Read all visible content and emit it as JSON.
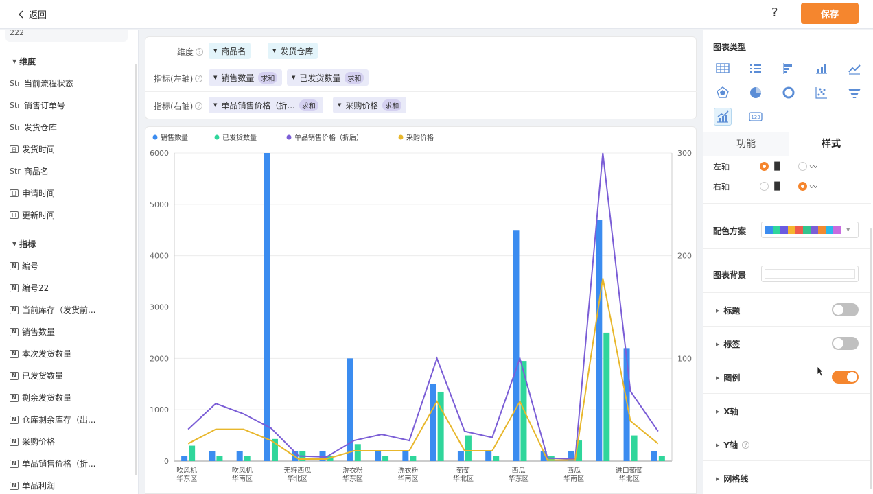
{
  "topbar": {
    "back_label": "返回",
    "help_label": "?",
    "save_label": "保存"
  },
  "left_panel": {
    "top_field": "222",
    "dimension_title": "维度",
    "dimensions": [
      {
        "type": "Str",
        "label": "当前流程状态"
      },
      {
        "type": "Str",
        "label": "销售订单号"
      },
      {
        "type": "Str",
        "label": "发货仓库"
      },
      {
        "type": "date",
        "label": "发货时间"
      },
      {
        "type": "Str",
        "label": "商品名"
      },
      {
        "type": "date",
        "label": "申请时间"
      },
      {
        "type": "date",
        "label": "更新时间"
      }
    ],
    "metric_title": "指标",
    "metrics": [
      "编号",
      "编号22",
      "当前库存（发货前...",
      "销售数量",
      "本次发货数量",
      "已发货数量",
      "剩余发货数量",
      "仓库剩余库存（出...",
      "采购价格",
      "单品销售价格（折...",
      "单品利润"
    ],
    "date_icon": "日",
    "num_icon": "N"
  },
  "config": {
    "dimension_label": "维度",
    "left_metric_label": "指标(左轴)",
    "right_metric_label": "指标(右轴)",
    "dimensions": [
      "商品名",
      "发货仓库"
    ],
    "left_metrics": [
      {
        "name": "销售数量",
        "agg": "求和"
      },
      {
        "name": "已发货数量",
        "agg": "求和"
      }
    ],
    "right_metrics": [
      {
        "name": "单品销售价格（折...",
        "agg": "求和"
      },
      {
        "name": "采购价格",
        "agg": "求和"
      }
    ]
  },
  "chart_data": {
    "type": "bar",
    "legend_position": "top-left",
    "categories": [
      [
        "吹风机",
        "华东区"
      ],
      [
        "",
        ""
      ],
      [
        "吹风机",
        "华南区"
      ],
      [
        "",
        ""
      ],
      [
        "无籽西瓜",
        "华北区"
      ],
      [
        "",
        ""
      ],
      [
        "洗衣粉",
        "华东区"
      ],
      [
        "",
        ""
      ],
      [
        "洗衣粉",
        "华南区"
      ],
      [
        "",
        ""
      ],
      [
        "葡萄",
        "华北区"
      ],
      [
        "",
        ""
      ],
      [
        "西瓜",
        "华东区"
      ],
      [
        "",
        ""
      ],
      [
        "西瓜",
        "华南区"
      ],
      [
        "",
        ""
      ],
      [
        "进口葡萄",
        "华北区"
      ],
      [
        "",
        ""
      ]
    ],
    "left_axis": {
      "min": 0,
      "max": 6000,
      "ticks": [
        0,
        1000,
        2000,
        3000,
        4000,
        5000,
        6000
      ]
    },
    "right_axis": {
      "min": 0,
      "max": 300,
      "ticks": [
        100,
        200,
        300
      ]
    },
    "series": [
      {
        "name": "销售数量",
        "kind": "bar",
        "axis": "left",
        "color": "#3b8cf0",
        "values": [
          100,
          200,
          200,
          6000,
          200,
          200,
          2000,
          200,
          200,
          1500,
          200,
          200,
          4500,
          200,
          200,
          4700,
          2200,
          200
        ]
      },
      {
        "name": "已发货数量",
        "kind": "bar",
        "axis": "left",
        "color": "#2fd69b",
        "values": [
          300,
          100,
          100,
          430,
          200,
          100,
          330,
          100,
          100,
          1350,
          500,
          100,
          1950,
          100,
          400,
          2500,
          500,
          100
        ]
      },
      {
        "name": "单品销售价格（折后）",
        "kind": "line",
        "axis": "right",
        "color": "#7b5ed6",
        "values": [
          31,
          56,
          46,
          32,
          5,
          4,
          20,
          26,
          20,
          100,
          29,
          23,
          100,
          3,
          2,
          300,
          68,
          29
        ]
      },
      {
        "name": "采购价格",
        "kind": "line",
        "axis": "right",
        "color": "#e8b72c",
        "values": [
          17,
          31,
          31,
          20,
          2,
          2,
          10,
          10,
          10,
          58,
          10,
          10,
          58,
          1,
          1,
          178,
          39,
          17
        ]
      }
    ]
  },
  "right_panel": {
    "chart_type_title": "图表类型",
    "chart_types": [
      "table-icon",
      "list-icon",
      "horizontal-bar-icon",
      "bar-chart-icon",
      "line-chart-icon",
      "radar-icon",
      "pie-icon",
      "donut-icon",
      "scatter-icon",
      "funnel-icon",
      "combo-chart-icon",
      "number-card-icon"
    ],
    "tabs": [
      {
        "label": "功能",
        "active": false
      },
      {
        "label": "样式",
        "active": true
      }
    ],
    "left_axis_label": "左轴",
    "right_axis_label": "右轴",
    "palette_label": "配色方案",
    "palette_colors": [
      "#3b8cf0",
      "#2fd69b",
      "#6a5be0",
      "#f5b52e",
      "#ef5a4f",
      "#33c48e",
      "#7b5ed6",
      "#f28a30",
      "#2ab9e8",
      "#c86be0"
    ],
    "bg_label": "图表背景",
    "title_label": "标题",
    "label_label": "标签",
    "legend_label": "图例",
    "xaxis_label": "X轴",
    "yaxis_label": "Y轴",
    "grid_label": "网格线"
  }
}
